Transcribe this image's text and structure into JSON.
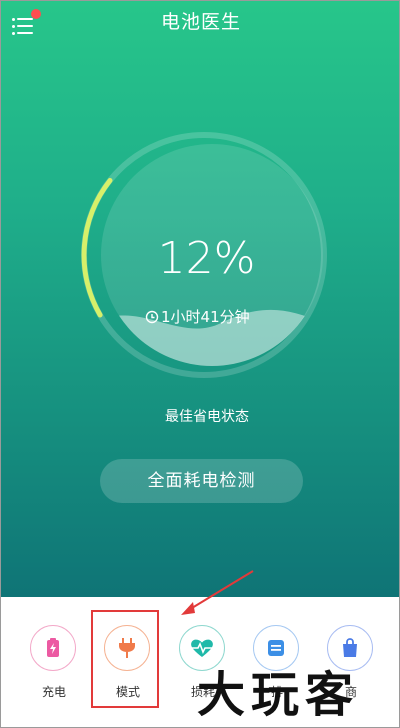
{
  "header": {
    "title": "电池医生"
  },
  "battery": {
    "percent": "12%",
    "level": 0.12,
    "remaining": "1小时41分钟",
    "status": "最佳省电状态"
  },
  "actions": {
    "detect_label": "全面耗电检测"
  },
  "tabs": [
    {
      "label": "充电",
      "icon": "charging-icon",
      "color": "#ec5aa2"
    },
    {
      "label": "模式",
      "icon": "plug-icon",
      "color": "#f07a4a"
    },
    {
      "label": "损耗",
      "icon": "heartbeat-icon",
      "color": "#1fb9a9"
    },
    {
      "label": "排",
      "icon": "list-icon",
      "color": "#3c8fe6"
    },
    {
      "label": "商",
      "icon": "shopping-bag-icon",
      "color": "#4a7be6"
    }
  ],
  "watermark": {
    "text": "大玩客"
  },
  "colors": {
    "accent": "#1fae8a",
    "highlight": "#e23a3a",
    "gauge_level": "#d7f06a"
  }
}
